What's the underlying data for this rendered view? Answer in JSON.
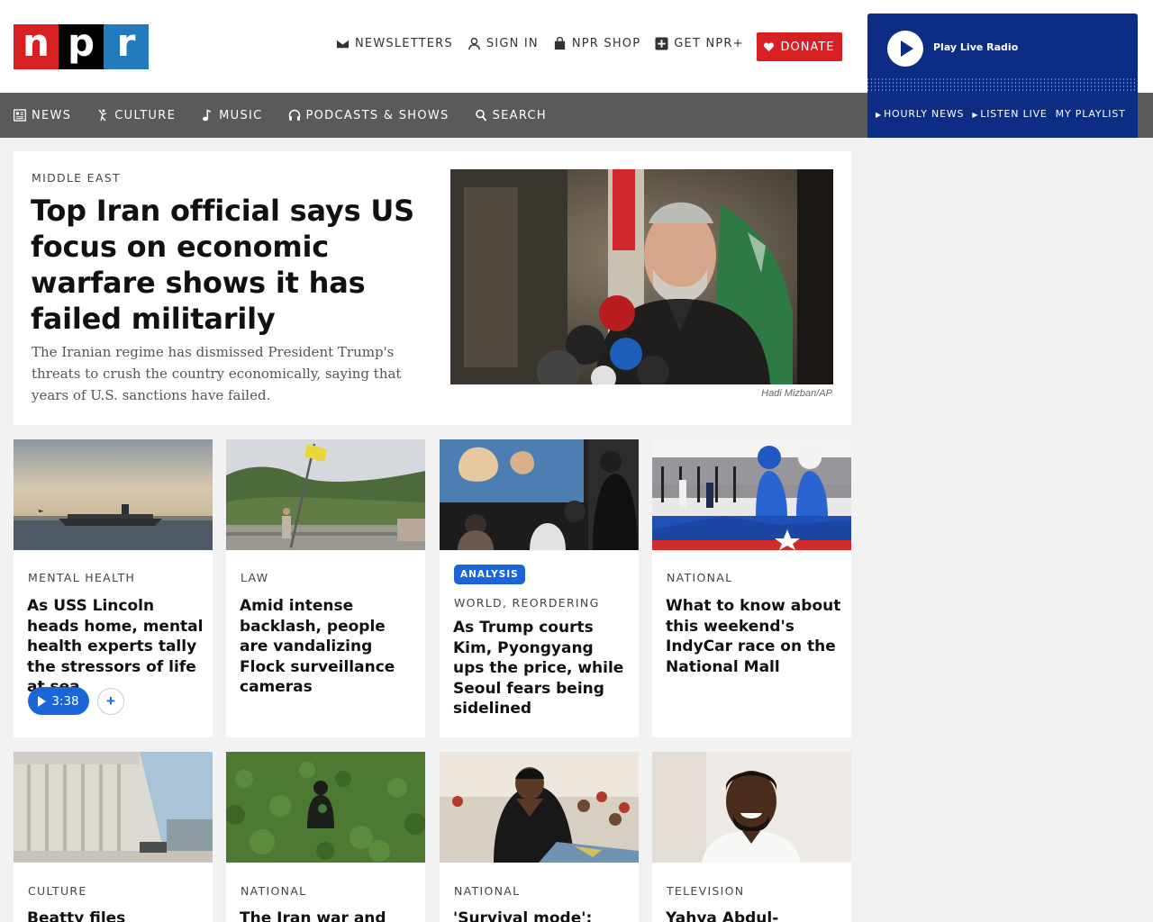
{
  "header": {
    "logo": {
      "n": "n",
      "p": "p",
      "r": "r"
    },
    "utility_links": [
      {
        "label": "NEWSLETTERS",
        "icon": "envelope-icon"
      },
      {
        "label": "SIGN IN",
        "icon": "user-icon"
      },
      {
        "label": "NPR SHOP",
        "icon": "shopping-bag-icon"
      },
      {
        "label": "GET NPR+",
        "icon": "plus-box-icon"
      }
    ],
    "donate_label": "DONATE"
  },
  "nav": {
    "items": [
      {
        "label": "NEWS",
        "icon": "newspaper-icon"
      },
      {
        "label": "CULTURE",
        "icon": "dancer-icon"
      },
      {
        "label": "MUSIC",
        "icon": "music-note-icon"
      },
      {
        "label": "PODCASTS & SHOWS",
        "icon": "headphones-icon"
      },
      {
        "label": "SEARCH",
        "icon": "search-icon"
      }
    ]
  },
  "player": {
    "play_label": "Play Live Radio",
    "links": [
      "HOURLY NEWS",
      "LISTEN LIVE",
      "MY PLAYLIST"
    ]
  },
  "hero": {
    "slug": "MIDDLE EAST",
    "headline": "Top Iran official says US focus on economic warfare shows it has failed militarily",
    "teaser": "The Iranian regime has dismissed President Trump's threats to crush the country economically, saying that years of U.S. sanctions have failed.",
    "credit": "Hadi Mizban/AP"
  },
  "cards_row1": [
    {
      "slug": "MENTAL HEALTH",
      "headline": "As USS Lincoln heads home, mental health experts tally the stressors of life at sea",
      "audio_duration": "3:38",
      "add_label": "+"
    },
    {
      "slug": "LAW",
      "headline": "Amid intense backlash, people are vandalizing Flock surveillance cameras"
    },
    {
      "badge": "ANALYSIS",
      "slug": "WORLD, REORDERING",
      "headline": "As Trump courts Kim, Pyongyang ups the price, while Seoul fears being sidelined"
    },
    {
      "slug": "NATIONAL",
      "headline": "What to know about this weekend's IndyCar race on the National Mall"
    }
  ],
  "cards_row2": [
    {
      "slug": "CULTURE",
      "headline": "Beatty files"
    },
    {
      "slug": "NATIONAL",
      "headline": "The Iran war and"
    },
    {
      "slug": "NATIONAL",
      "headline": "'Survival mode':"
    },
    {
      "slug": "TELEVISION",
      "headline": "Yahya Abdul-Mateen"
    }
  ],
  "colors": {
    "npr_red": "#d62021",
    "npr_blue": "#237bbd",
    "player_blue": "#0d2c84",
    "nav_gray": "#5a5a5a",
    "accent_blue": "#1a66d9"
  }
}
